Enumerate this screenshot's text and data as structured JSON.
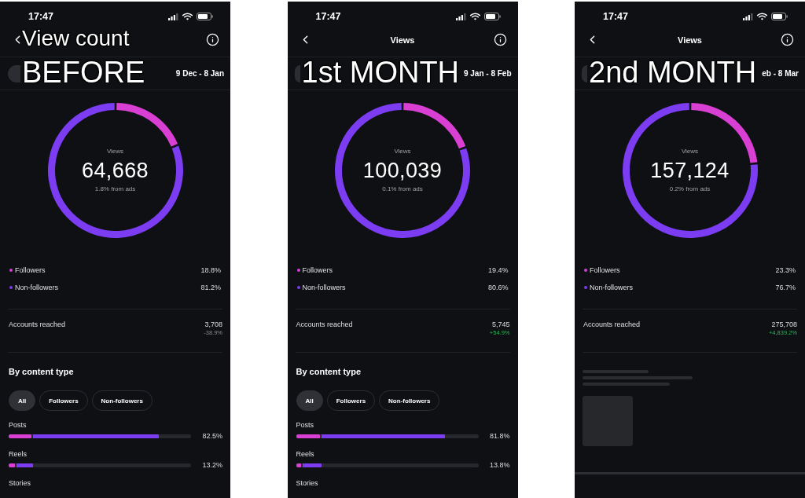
{
  "panels": [
    {
      "caption": [
        {
          "text": "View count",
          "kind": "subtitle"
        },
        {
          "text": "BEFORE",
          "kind": "headline"
        }
      ],
      "status_bar": {
        "time": "17:47"
      },
      "date_range": "9 Dec - 8 Jan",
      "views": {
        "label": "Views",
        "count": "64,668",
        "ads_share": "1.8% from ads",
        "chart_data": {
          "type": "donut",
          "values": [
            18.8,
            81.2
          ]
        }
      },
      "audience": [
        {
          "label": "Followers",
          "value": "18.8%",
          "color": "#d83fd2"
        },
        {
          "label": "Non-followers",
          "value": "81.2%",
          "color": "#7c3cf2"
        }
      ],
      "accounts_reached": {
        "label": "Accounts reached",
        "value": "3,708",
        "change": "-38.9%",
        "positive": false
      },
      "content": {
        "kind": "breakdown",
        "title": "By content type",
        "filters": [
          {
            "label": "All",
            "selected": true
          },
          {
            "label": "Followers",
            "selected": false
          },
          {
            "label": "Non-followers",
            "selected": false
          }
        ],
        "rows": [
          {
            "label": "Posts",
            "value": "82.5%",
            "segments": [
              {
                "level": 0.125
              },
              {
                "level": 0.825
              }
            ]
          },
          {
            "label": "Reels",
            "value": "13.2%",
            "segments": [
              {
                "level": 0.034
              },
              {
                "level": 0.132
              }
            ]
          },
          {
            "label": "Stories"
          }
        ]
      }
    },
    {
      "caption": [
        {
          "text": "1st MONTH",
          "kind": "headline"
        }
      ],
      "status_bar": {
        "time": "17:47"
      },
      "title": "Views",
      "date_range": "9 Jan - 8 Feb",
      "views": {
        "label": "Views",
        "count": "100,039",
        "ads_share": "0.1% from ads",
        "chart_data": {
          "type": "donut",
          "values": [
            19.4,
            80.6
          ]
        }
      },
      "audience": [
        {
          "label": "Followers",
          "value": "19.4%",
          "color": "#d83fd2"
        },
        {
          "label": "Non-followers",
          "value": "80.6%",
          "color": "#7c3cf2"
        }
      ],
      "accounts_reached": {
        "label": "Accounts reached",
        "value": "5,745",
        "change": "+54.9%",
        "positive": true
      },
      "content": {
        "kind": "breakdown",
        "title": "By content type",
        "filters": [
          {
            "label": "All",
            "selected": true
          },
          {
            "label": "Followers",
            "selected": false
          },
          {
            "label": "Non-followers",
            "selected": false
          }
        ],
        "rows": [
          {
            "label": "Posts",
            "value": "81.8%",
            "segments": [
              {
                "level": 0.13
              },
              {
                "level": 0.818
              }
            ]
          },
          {
            "label": "Reels",
            "value": "13.8%",
            "segments": [
              {
                "level": 0.03
              },
              {
                "level": 0.138
              }
            ]
          },
          {
            "label": "Stories"
          }
        ]
      }
    },
    {
      "caption": [
        {
          "text": "2nd MONTH",
          "kind": "headline"
        }
      ],
      "status_bar": {
        "time": "17:47"
      },
      "title": "Views",
      "date_range": "eb - 8 Mar",
      "views": {
        "label": "Views",
        "count": "157,124",
        "ads_share": "0.2% from ads",
        "chart_data": {
          "type": "donut",
          "values": [
            23.3,
            76.7
          ]
        }
      },
      "audience": [
        {
          "label": "Followers",
          "value": "23.3%",
          "color": "#d83fd2"
        },
        {
          "label": "Non-followers",
          "value": "76.7%",
          "color": "#7c3cf2"
        }
      ],
      "accounts_reached": {
        "label": "Accounts reached",
        "value": "275,708",
        "change": "+4,839.2%",
        "positive": true
      },
      "content": {
        "kind": "loading"
      }
    }
  ]
}
